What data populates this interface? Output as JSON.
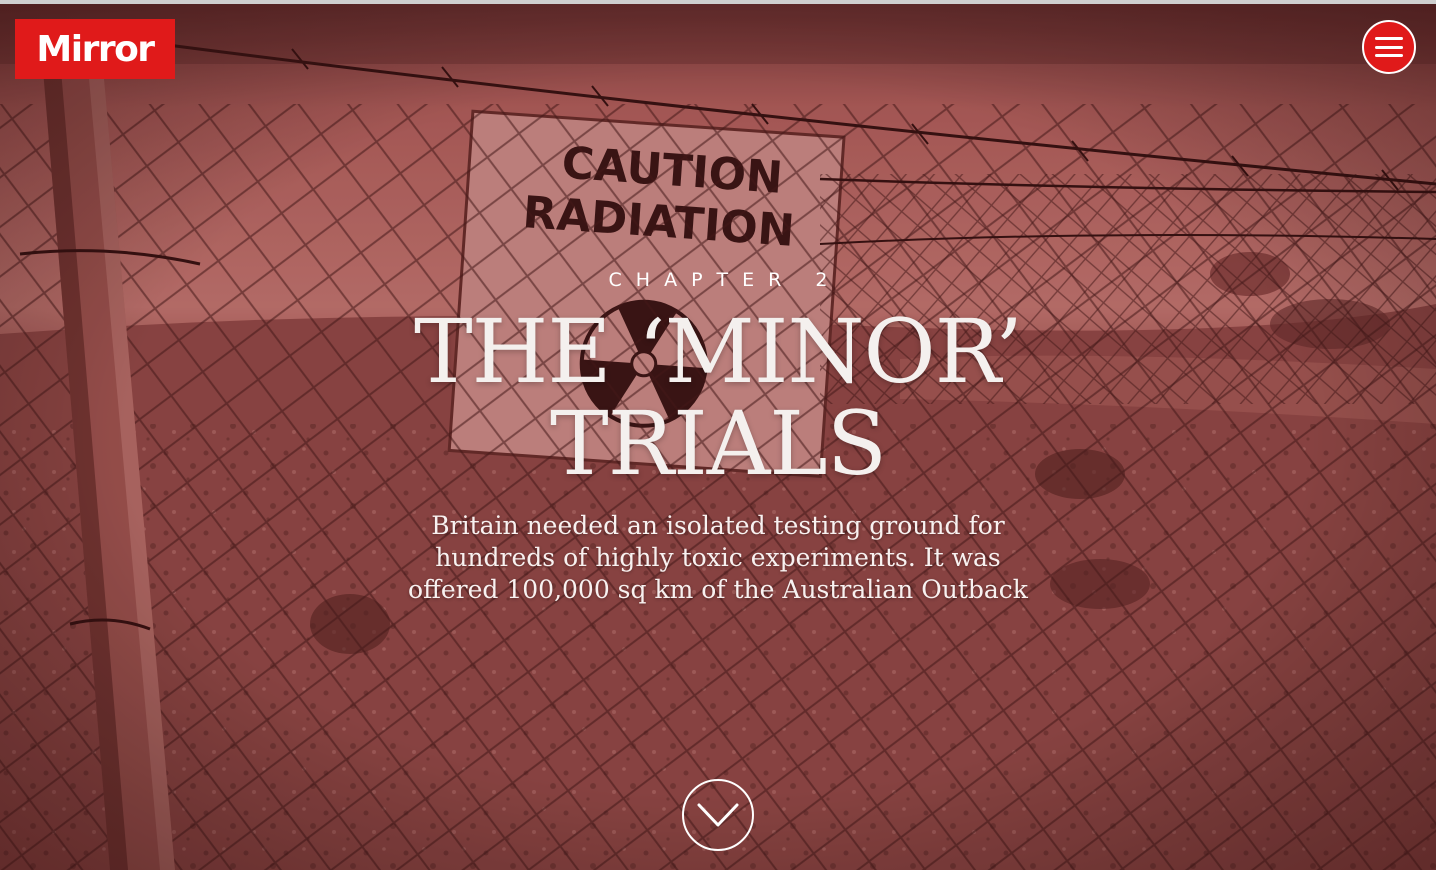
{
  "header": {
    "logo_text": "Mirror",
    "brand_color": "#e01a1a",
    "menu_icon": "hamburger-menu-icon"
  },
  "hero": {
    "background": "barbed-wire-fence-with-caution-radiation-sign",
    "overlay_color": "#8a3a3a",
    "sign_line_1": "CAUTION",
    "sign_line_2": "RADIATION",
    "chapter_label": "Chapter 2",
    "headline_line_1": "THE ‘MINOR’",
    "headline_line_2": "TRIALS",
    "standfirst": "Britain needed an isolated testing ground for hundreds of highly toxic experiments. It was offered 100,000 sq km of the Australian Outback",
    "scroll_icon": "chevron-down-icon"
  }
}
